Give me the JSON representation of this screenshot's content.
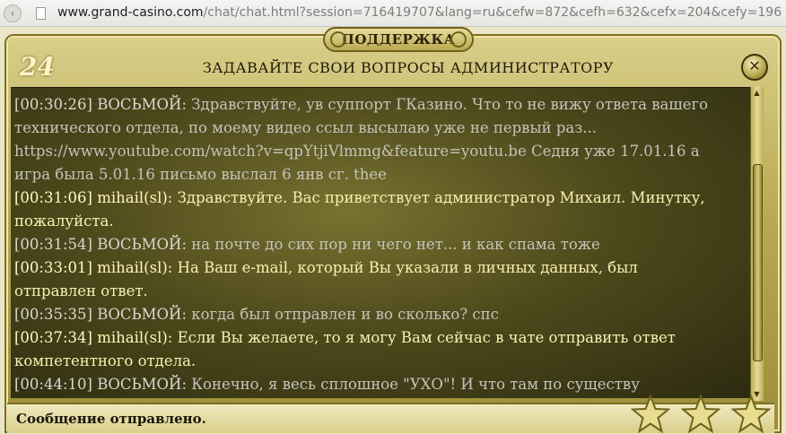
{
  "browser": {
    "nav_glyph": "‹",
    "url_host": "www.grand-casino.com",
    "url_path": "/chat/chat.html?session=716419707&lang=ru&cefw=872&cefh=632&cefx=204&cefy=196"
  },
  "window": {
    "title": "ПОДДЕРЖКА",
    "subtitle": "ЗАДАВАЙТЕ СВОИ ВОПРОСЫ АДМИНИСТРАТОРУ",
    "logo": "24",
    "close_glyph": "✕"
  },
  "messages": [
    {
      "role": "user",
      "time": "[00:30:26]",
      "nick": "ВОСЬМОЙ:",
      "text": "Здравствуйте, ув суппорт ГКазино. Что то не вижу ответа вашего технического отдела, по моему видео ссыл высылаю уже не первый раз... https://www.youtube.com/watch?v=qpYtjiVlmmg&feature=youtu.be Седня уже 17.01.16 а игра была 5.01.16 письмо выслал 6 янв сг. thee"
    },
    {
      "role": "admin",
      "time": "[00:31:06]",
      "nick": "mihail(sl):",
      "text": "Здравствуйте. Вас приветствует администратор Михаил. Минутку, пожалуйста."
    },
    {
      "role": "user",
      "time": "[00:31:54]",
      "nick": "ВОСЬМОЙ:",
      "text": "на почте до сих пор ни чего нет... и как спама тоже"
    },
    {
      "role": "admin",
      "time": "[00:33:01]",
      "nick": "mihail(sl):",
      "text": "На Ваш e-mail, который Вы указали в личных данных, был отправлен ответ."
    },
    {
      "role": "user",
      "time": "[00:35:35]",
      "nick": "ВОСЬМОЙ:",
      "text": "когда был отправлен и во сколько? спс"
    },
    {
      "role": "admin",
      "time": "[00:37:34]",
      "nick": "mihail(sl):",
      "text": "Если Вы желаете, то я могу Вам сейчас в чате отправить ответ компетентного отдела."
    },
    {
      "role": "user",
      "time": "[00:44:10]",
      "nick": "ВОСЬМОЙ:",
      "text": "Конечно, я весь сплошное \"УХО\"! И что там по существу"
    }
  ],
  "scrollbar": {
    "up_glyph": "▲",
    "down_glyph": "▼"
  },
  "status": {
    "text": "Сообщение отправлено."
  },
  "rating": {
    "stars": 3
  },
  "colors": {
    "admin_text": "#f6f1b0",
    "user_text": "#c4c4bc",
    "frame_gold": "#b9aa52"
  }
}
